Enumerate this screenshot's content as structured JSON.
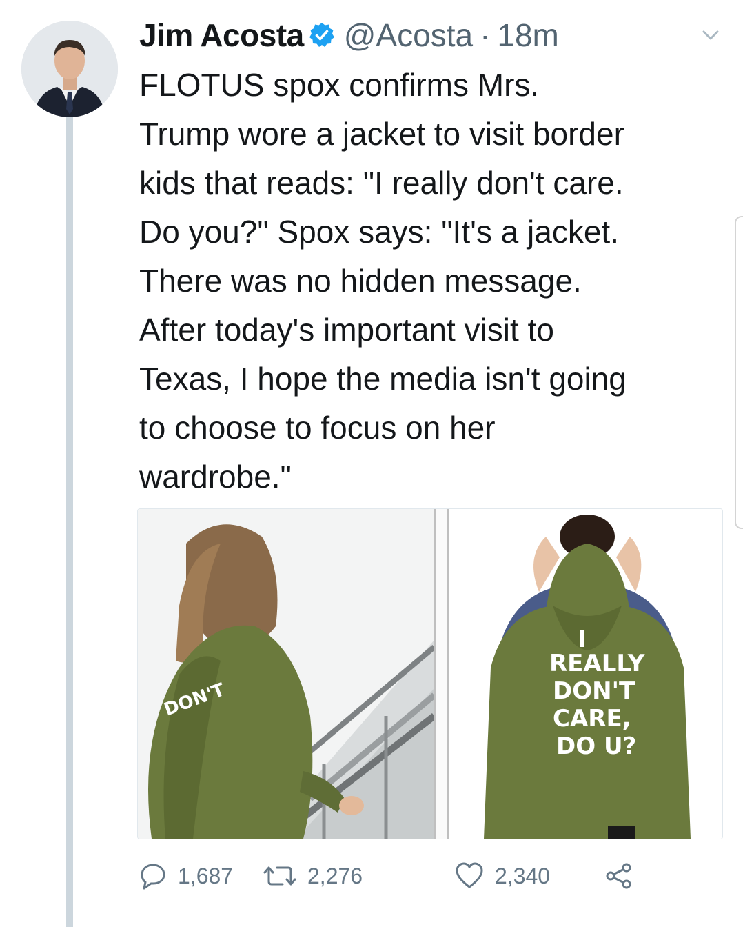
{
  "tweet": {
    "author_name": "Jim Acosta",
    "handle": "@Acosta",
    "separator": "·",
    "time": "18m",
    "text_lines": [
      "FLOTUS spox confirms Mrs.",
      "Trump wore a jacket to visit border",
      "kids that reads: \"I really don't care.",
      "Do you?\" Spox says: \"It's a jacket.",
      "There was no hidden message.",
      "After today's important visit to",
      "Texas, I hope the media isn't going",
      "to choose to focus on her",
      "wardrobe.\""
    ],
    "jacket_text": [
      "I",
      "REALLY",
      "DON'T",
      "CARE,",
      "DO U?"
    ]
  },
  "actions": {
    "replies": "1,687",
    "retweets": "2,276",
    "likes": "2,340"
  },
  "icons": {
    "verified": "verified-badge-icon",
    "caret": "chevron-down-icon",
    "reply": "reply-icon",
    "retweet": "retweet-icon",
    "like": "heart-icon",
    "share": "share-icon"
  },
  "colors": {
    "verified": "#1da1f2",
    "text": "#14171a",
    "secondary": "#657786",
    "thread_line": "#ccd6dd",
    "jacket": "#6b7a3d"
  }
}
